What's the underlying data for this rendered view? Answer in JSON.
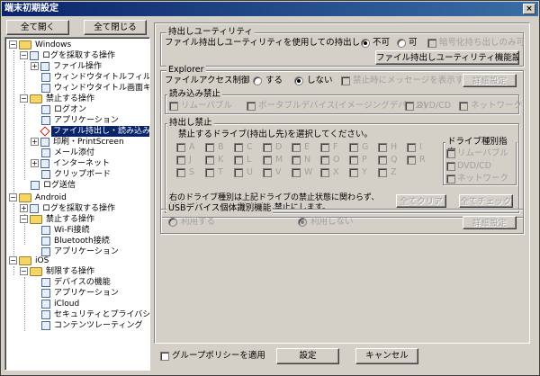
{
  "window": {
    "title": "端末初期設定",
    "close": "×"
  },
  "left": {
    "expand_all": "全て開く",
    "collapse_all": "全て閉じる"
  },
  "tree": {
    "windows": "Windows",
    "log_ops": "ログを採取する操作",
    "file_ops": "ファイル操作",
    "wintitle_filter": "ウィンドウタイトルフィルタ",
    "wintitle_capture": "ウィンドウタイトル画面キャ",
    "prohibit_ops": "禁止する操作",
    "logon": "ログオン",
    "application": "アプリケーション",
    "file_export": "ファイル持出し・読み込み",
    "print_screen": "印刷・PrintScreen",
    "mail_attach": "メール添付",
    "internet": "インターネット",
    "clipboard": "クリップボード",
    "log_send": "ログ送信",
    "android": "Android",
    "a_log_ops": "ログを採取する操作",
    "a_prohibit": "禁止する操作",
    "wifi": "Wi-Fi接続",
    "bluetooth": "Bluetooth接続",
    "a_app": "アプリケーション",
    "ios": "iOS",
    "i_limit": "制限する操作",
    "device_func": "デバイスの機能",
    "i_app": "アプリケーション",
    "icloud": "iCloud",
    "security_privacy": "セキュリティとプライバシー",
    "content_rating": "コンテンツレーティング"
  },
  "g1": {
    "title": "持出しユーティリティ",
    "label": "ファイル持出しユーティリティを使用しての持出し",
    "opt_no": "不可",
    "opt_yes": "可",
    "encrypt_only": "暗号化持ち出しのみ可",
    "settings_btn": "ファイル持出しユーティリティ機能設定"
  },
  "g2": {
    "title": "Explorer",
    "access_label": "ファイルアクセス制御",
    "opt_do": "する",
    "opt_dont": "しない",
    "show_msg": "禁止時にメッセージを表示する",
    "detail_btn": "詳細設定",
    "read_title": "読み込み禁止",
    "removable": "リムーバブル",
    "portable": "ポータブルデバイス(イメージングデバイス)",
    "dvd": "DVD/CD",
    "network": "ネットワーク",
    "export_title": "持出し禁止",
    "drives_label": "禁止するドライブ(持出し先)を選択してください。",
    "drives": [
      "A",
      "B",
      "C",
      "D",
      "E",
      "F",
      "G",
      "H",
      "I",
      "J",
      "K",
      "L",
      "M",
      "N",
      "O",
      "P",
      "Q",
      "R",
      "S",
      "T",
      "U",
      "V",
      "W",
      "X",
      "Y",
      "Z"
    ],
    "type_title": "ドライブ種別指定",
    "t_removable": "リムーバブル",
    "t_dvd": "DVD/CD",
    "t_network": "ネットワーク",
    "note1": "右のドライブ種別は上記ドライブの禁止状態に関わらず、",
    "note2": "該当となるドライブを持出し禁止にします。",
    "clear_btn": "全てクリア",
    "check_btn": "全てチェック"
  },
  "g3": {
    "title": "USBデバイス個体識別機能",
    "use": "利用する",
    "not_use": "利用しない",
    "detail_btn": "詳細設定"
  },
  "footer": {
    "group_policy": "グループポリシーを適用",
    "ok": "設定",
    "cancel": "キャンセル"
  }
}
